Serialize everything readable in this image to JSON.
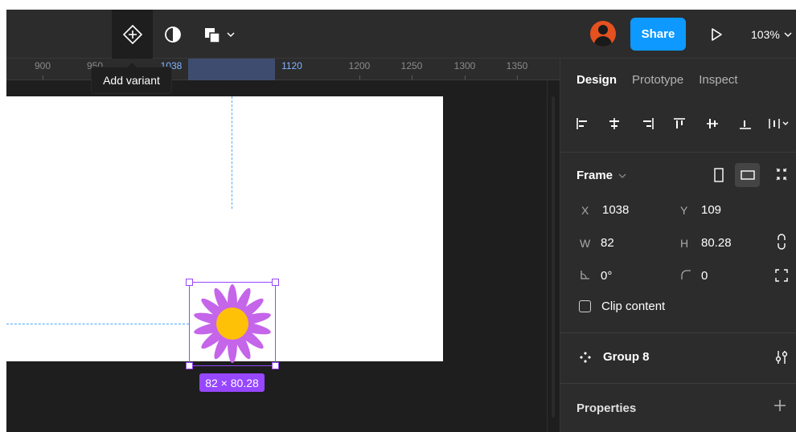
{
  "toolbar": {
    "share_label": "Share",
    "zoom_label": "103%",
    "icons": [
      "add-variant-icon",
      "contrast-icon",
      "shapes-icon",
      "chevron-down-icon",
      "avatar-icon",
      "play-icon"
    ]
  },
  "tooltip": {
    "text": "Add variant"
  },
  "ruler": {
    "ticks": [
      {
        "label": "900",
        "highlight": false
      },
      {
        "label": "950",
        "highlight": false
      },
      {
        "label": "1038",
        "highlight": true
      },
      {
        "label": "1120",
        "highlight": true
      },
      {
        "label": "1200",
        "highlight": false
      },
      {
        "label": "1250",
        "highlight": false
      },
      {
        "label": "1300",
        "highlight": false
      },
      {
        "label": "1350",
        "highlight": false
      }
    ]
  },
  "canvas": {
    "selection_badge": "82 × 80.28",
    "colors": {
      "petal": "#c565ea",
      "center": "#ffc107",
      "selection": "#9747ff",
      "guide": "#4aa8ff"
    }
  },
  "panel": {
    "tabs": [
      {
        "label": "Design",
        "active": true
      },
      {
        "label": "Prototype",
        "active": false
      },
      {
        "label": "Inspect",
        "active": false
      }
    ],
    "frame": {
      "title": "Frame",
      "x_label": "X",
      "x_value": "1038",
      "y_label": "Y",
      "y_value": "109",
      "w_label": "W",
      "w_value": "82",
      "h_label": "H",
      "h_value": "80.28",
      "rotation_value": "0°",
      "radius_value": "0",
      "clip_label": "Clip content"
    },
    "group": {
      "label": "Group 8"
    },
    "properties": {
      "label": "Properties"
    }
  }
}
